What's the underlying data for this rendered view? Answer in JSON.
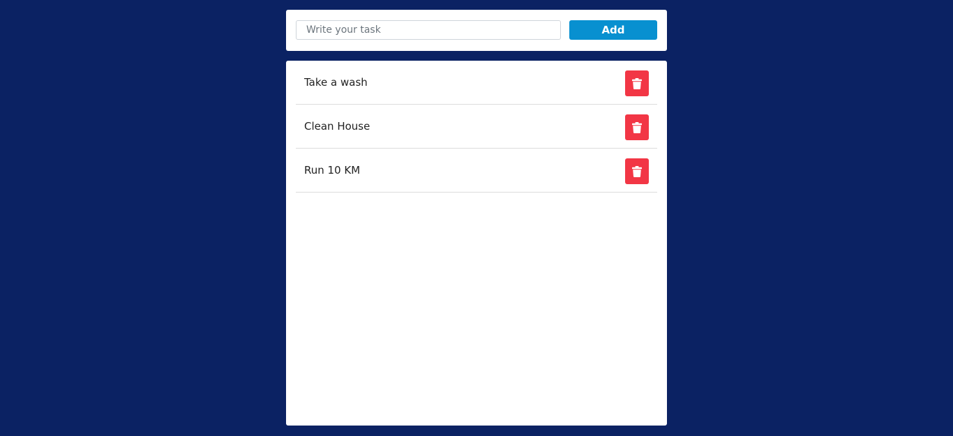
{
  "add_form": {
    "placeholder": "Write your task",
    "value": "",
    "add_label": "Add"
  },
  "tasks": [
    {
      "text": "Take a wash",
      "delete_icon": "trash-icon"
    },
    {
      "text": "Clean House",
      "delete_icon": "trash-icon"
    },
    {
      "text": "Run 10 KM",
      "delete_icon": "trash-icon"
    }
  ],
  "colors": {
    "background": "#0b2263",
    "add_button": "#0890d0",
    "delete_button": "#f23645"
  }
}
